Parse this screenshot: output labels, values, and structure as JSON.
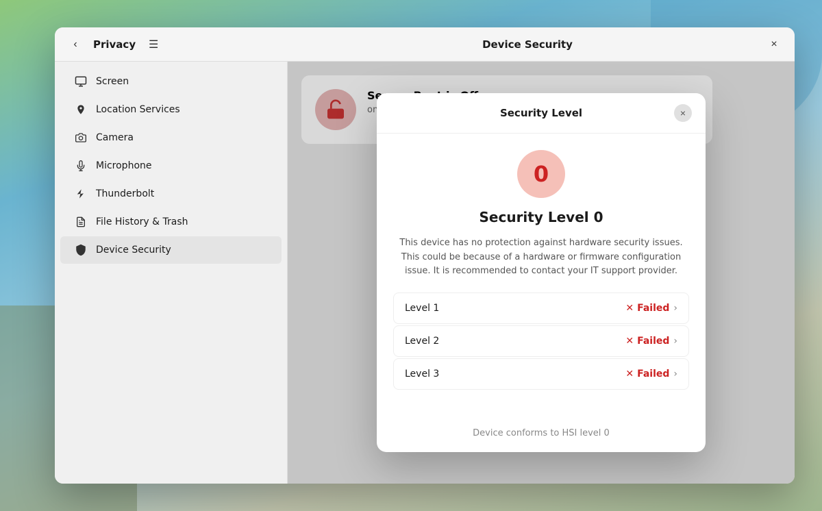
{
  "window": {
    "title": "Device Security",
    "close_label": "×",
    "back_label": "‹"
  },
  "sidebar": {
    "title": "Privacy",
    "hamburger_label": "☰",
    "items": [
      {
        "id": "screen",
        "label": "Screen",
        "icon": "🖥"
      },
      {
        "id": "location",
        "label": "Location Services",
        "icon": "📍"
      },
      {
        "id": "camera",
        "label": "Camera",
        "icon": "📷"
      },
      {
        "id": "microphone",
        "label": "Microphone",
        "icon": "🎙"
      },
      {
        "id": "thunderbolt",
        "label": "Thunderbolt",
        "icon": "⚡"
      },
      {
        "id": "filehistory",
        "label": "File History & Trash",
        "icon": "📋"
      },
      {
        "id": "devicesecurity",
        "label": "Device Security",
        "icon": "🛡",
        "active": true
      }
    ]
  },
  "background_card": {
    "title": "Secure Boot is Off",
    "description": "on when the device is started.",
    "icon": "🔓"
  },
  "modal": {
    "title": "Security Level",
    "close_label": "×",
    "badge_number": "0",
    "heading": "Security Level 0",
    "description": "This device has no protection against hardware security issues. This could be because of a hardware or firmware configuration issue. It is recommended to contact your IT support provider.",
    "levels": [
      {
        "label": "Level 1",
        "status": "Failed"
      },
      {
        "label": "Level 2",
        "status": "Failed"
      },
      {
        "label": "Level 3",
        "status": "Failed"
      }
    ],
    "footer_text": "Device conforms to HSI level 0",
    "x_icon": "✕",
    "chevron": "›"
  }
}
